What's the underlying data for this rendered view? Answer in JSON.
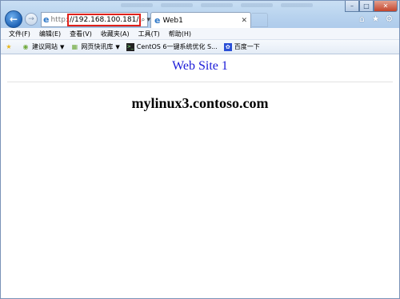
{
  "nav": {
    "back_icon": "←",
    "forward_icon": "→"
  },
  "address": {
    "protocol": "http:",
    "url": "//192.168.100.181/",
    "search_icon": "⌕",
    "dropdown_icon": "▾",
    "refresh_icon": "↻"
  },
  "tab": {
    "label": "Web1",
    "close_icon": "✕"
  },
  "window_controls": {
    "minimize": "–",
    "maximize": "□",
    "close": "✕"
  },
  "toolbar_icons": {
    "home": "⌂",
    "favorites": "★",
    "tools": "⚙"
  },
  "menu": [
    "文件(F)",
    "编辑(E)",
    "查看(V)",
    "收藏夹(A)",
    "工具(T)",
    "帮助(H)"
  ],
  "favorites": [
    {
      "label": "建议网站",
      "dropdown": "▼"
    },
    {
      "label": "网页快讯库",
      "dropdown": "▼"
    },
    {
      "label": "CentOS 6一键系统优化 S...",
      "dropdown": ""
    },
    {
      "label": "百度一下",
      "dropdown": ""
    }
  ],
  "page": {
    "site_title": "Web Site 1",
    "hostname": "mylinux3.contoso.com"
  },
  "colors": {
    "title_link": "#1a1ad8",
    "highlight_border": "#e0201a"
  }
}
